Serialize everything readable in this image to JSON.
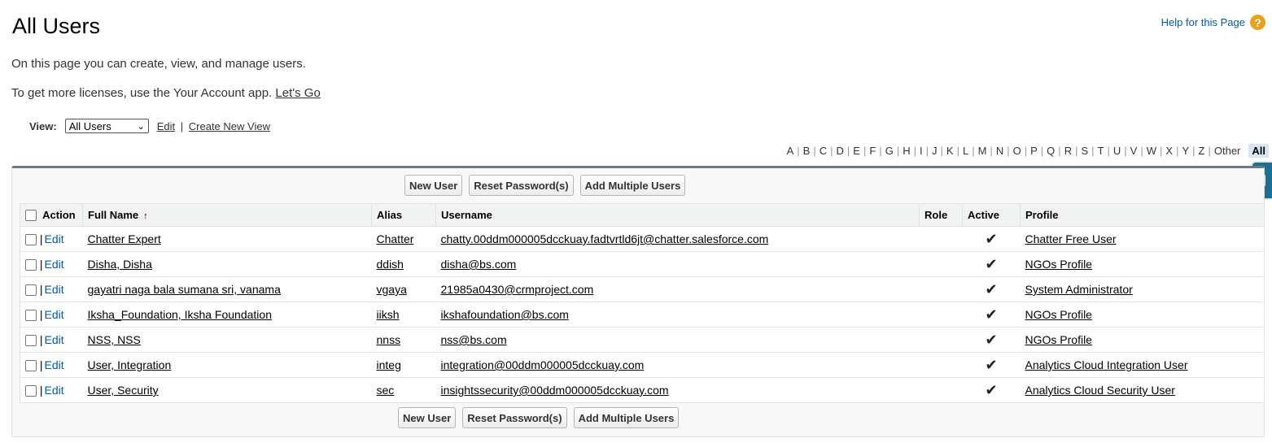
{
  "page": {
    "title": "All Users",
    "help_label": "Help for this Page",
    "help_icon": "?",
    "intro_line1": "On this page you can create, view, and manage users.",
    "intro_line2": "To get more licenses, use the Your Account app.",
    "lets_go": "Let's Go"
  },
  "view": {
    "label": "View:",
    "selected": "All Users",
    "edit": "Edit",
    "separator": "|",
    "create_new": "Create New View"
  },
  "alphabet": [
    "A",
    "B",
    "C",
    "D",
    "E",
    "F",
    "G",
    "H",
    "I",
    "J",
    "K",
    "L",
    "M",
    "N",
    "O",
    "P",
    "Q",
    "R",
    "S",
    "T",
    "U",
    "V",
    "W",
    "X",
    "Y",
    "Z",
    "Other"
  ],
  "alphabet_all": "All",
  "buttons": {
    "new_user": "New User",
    "reset_password": "Reset Password(s)",
    "add_multiple": "Add Multiple Users"
  },
  "columns": {
    "action": "Action",
    "full_name": "Full Name",
    "sort_indicator": "↑",
    "alias": "Alias",
    "username": "Username",
    "role": "Role",
    "active": "Active",
    "profile": "Profile"
  },
  "row_action": {
    "separator": "|",
    "edit": "Edit"
  },
  "users": [
    {
      "full_name": "Chatter Expert",
      "alias": "Chatter",
      "username": "chatty.00ddm000005dcckuay.fadtvrtld6jt@chatter.salesforce.com",
      "role": "",
      "active": "✔",
      "profile": "Chatter Free User"
    },
    {
      "full_name": "Disha, Disha",
      "alias": "ddish",
      "username": "disha@bs.com",
      "role": "",
      "active": "✔",
      "profile": "NGOs Profile"
    },
    {
      "full_name": "gayatri naga bala sumana sri, vanama",
      "alias": "vgaya",
      "username": "21985a0430@crmproject.com",
      "role": "",
      "active": "✔",
      "profile": "System Administrator"
    },
    {
      "full_name": "Iksha_Foundation, Iksha Foundation",
      "alias": "iiksh",
      "username": "ikshafoundation@bs.com",
      "role": "",
      "active": "✔",
      "profile": "NGOs Profile"
    },
    {
      "full_name": "NSS, NSS",
      "alias": "nnss",
      "username": "nss@bs.com",
      "role": "",
      "active": "✔",
      "profile": "NGOs Profile"
    },
    {
      "full_name": "User, Integration",
      "alias": "integ",
      "username": "integration@00ddm000005dcckuay.com",
      "role": "",
      "active": "✔",
      "profile": "Analytics Cloud Integration User"
    },
    {
      "full_name": "User, Security",
      "alias": "sec",
      "username": "insightssecurity@00ddm000005dcckuay.com",
      "role": "",
      "active": "✔",
      "profile": "Analytics Cloud Security User"
    }
  ],
  "colors": {
    "link_blue": "#015ba7",
    "help_orange": "#e9a21b",
    "side_tab": "#1f6f93",
    "panel_border_top": "#6f7785"
  }
}
